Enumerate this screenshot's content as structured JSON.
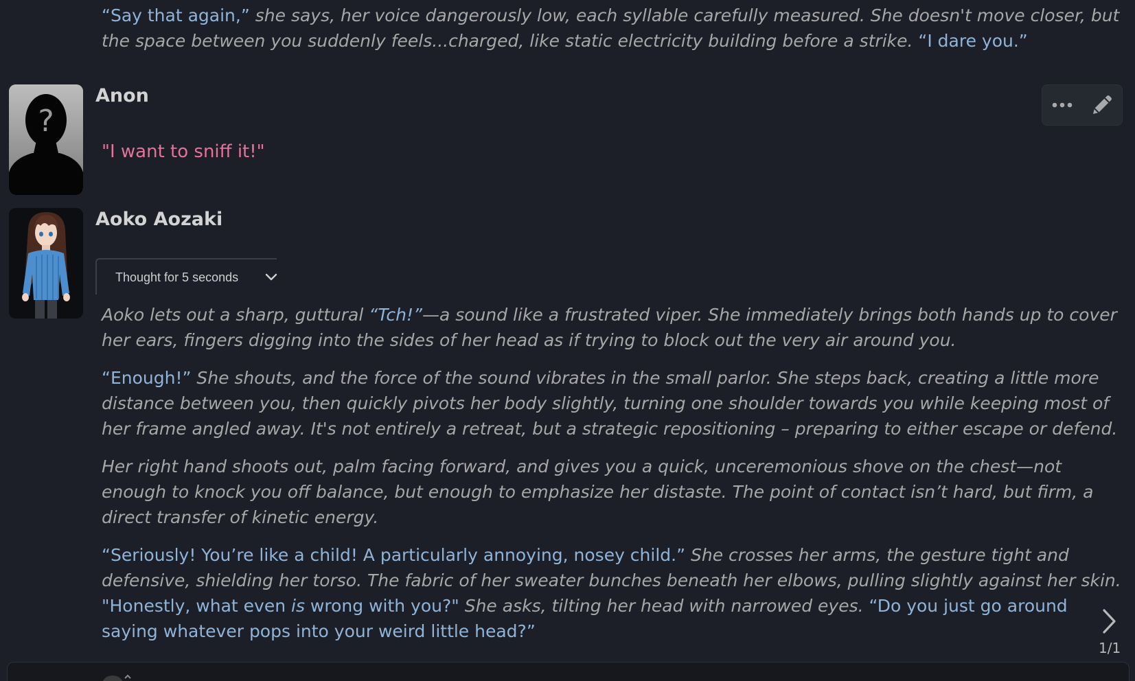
{
  "top_message": {
    "segments": [
      {
        "kind": "quote",
        "text": "“Say that again,”"
      },
      {
        "kind": "narration",
        "text": " she says, her voice dangerously low, each syllable carefully measured. She doesn't move closer, but the space between you suddenly feels...charged, like static electricity building before a strike. "
      },
      {
        "kind": "quote",
        "text": "“I dare you.”"
      }
    ]
  },
  "anon": {
    "name": "Anon",
    "avatar_icon": "silhouette-question-icon",
    "text": "\"I want to sniff it!\""
  },
  "actions": {
    "more_icon": "ellipsis-icon",
    "edit_icon": "pencil-icon"
  },
  "aoko": {
    "name": "Aoko Aozaki",
    "reasoning_label": "Thought for 5 seconds",
    "p1": {
      "a": "Aoko lets out a sharp, guttural ",
      "b": "“Tch!”",
      "c": "—a sound like a frustrated viper. She immediately brings both hands up to cover her ears, fingers digging into the sides of her head as if trying to block out the very air around you."
    },
    "p2": {
      "a": "“Enough!”",
      "b": " She shouts, and the force of the sound vibrates in the small parlor. She steps back, creating a little more distance between you, then quickly pivots her body slightly, turning one shoulder towards you while keeping most of her frame angled away. It's not entirely a retreat, but a strategic repositioning – preparing to either escape or defend."
    },
    "p3": "Her right hand shoots out, palm facing forward, and gives you a quick, unceremonious shove on the chest—not enough to knock you off balance, but enough to emphasize her distaste. The point of contact isn’t hard, but firm, a direct transfer of kinetic energy.",
    "p4": {
      "a": "“Seriously! You’re like a child! A particularly annoying, nosey child.”",
      "b": " She crosses her arms, the gesture tight and defensive, shielding her torso. The fabric of her sweater bunches beneath her elbows, pulling slightly against her skin. ",
      "c": "\"Honestly, what even ",
      "d": "is",
      "e": " wrong with you?\"",
      "f": " She asks, tilting her head with narrowed eyes. ",
      "g": "“Do you just go around saying whatever pops into your weird little head?”"
    }
  },
  "swipe": {
    "counter": "1/1",
    "icon": "chevron-right-icon"
  },
  "colors": {
    "background": "#1c1f27",
    "narration": "#a7a7a7",
    "quote": "#8fb4d8",
    "user_text": "#e47299"
  }
}
